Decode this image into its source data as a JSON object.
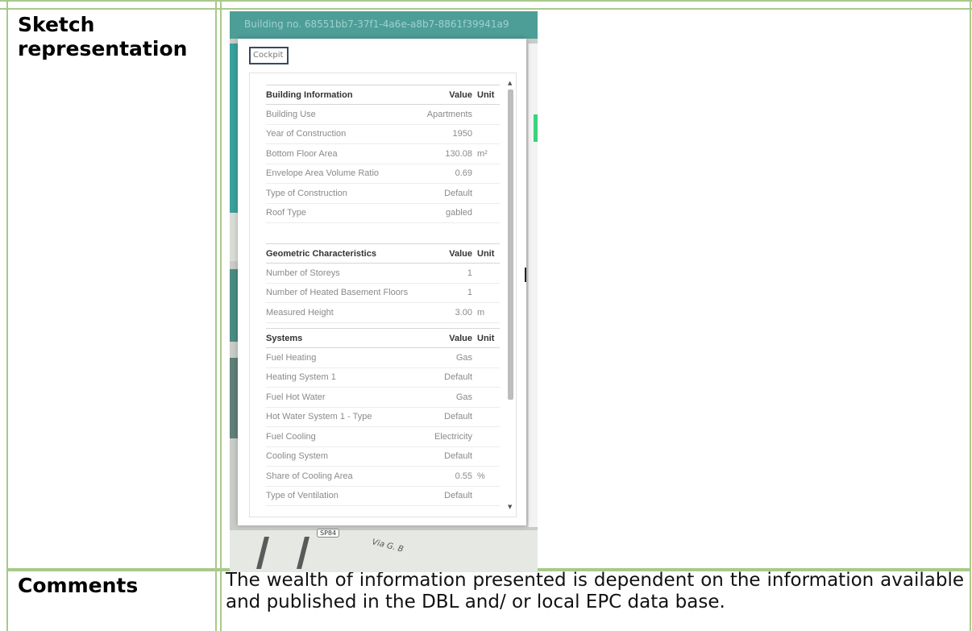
{
  "row_labels": {
    "sketch": "Sketch representation",
    "comments": "Comments"
  },
  "comment_text": "The wealth of information presented is dependent on the information available and published in the DBL and/ or local EPC data base.",
  "screenshot": {
    "title": "Building no. 68551bb7-37f1-4a6e-a8b7-8861f39941a9",
    "tab_label": "Cockpit",
    "map": {
      "road_badge": "SP84",
      "road_name": "Via G. B"
    },
    "sections": [
      {
        "header": {
          "name": "Building Information",
          "value": "Value",
          "unit": "Unit"
        },
        "rows": [
          {
            "name": "Building Use",
            "value": "Apartments",
            "unit": ""
          },
          {
            "name": "Year of Construction",
            "value": "1950",
            "unit": ""
          },
          {
            "name": "Bottom Floor Area",
            "value": "130.08",
            "unit": "m²"
          },
          {
            "name": "Envelope Area Volume Ratio",
            "value": "0.69",
            "unit": ""
          },
          {
            "name": "Type of Construction",
            "value": "Default",
            "unit": ""
          },
          {
            "name": "Roof Type",
            "value": "gabled",
            "unit": ""
          }
        ]
      },
      {
        "header": {
          "name": "Geometric Characteristics",
          "value": "Value",
          "unit": "Unit"
        },
        "rows": [
          {
            "name": "Number of Storeys",
            "value": "1",
            "unit": ""
          },
          {
            "name": "Number of Heated Basement Floors",
            "value": "1",
            "unit": ""
          },
          {
            "name": "Measured Height",
            "value": "3.00",
            "unit": "m"
          }
        ]
      },
      {
        "header": {
          "name": "Systems",
          "value": "Value",
          "unit": "Unit"
        },
        "rows": [
          {
            "name": "Fuel Heating",
            "value": "Gas",
            "unit": ""
          },
          {
            "name": "Heating System 1",
            "value": "Default",
            "unit": ""
          },
          {
            "name": "Fuel Hot Water",
            "value": "Gas",
            "unit": ""
          },
          {
            "name": "Hot Water System 1 - Type",
            "value": "Default",
            "unit": ""
          },
          {
            "name": "Fuel Cooling",
            "value": "Electricity",
            "unit": ""
          },
          {
            "name": "Cooling System",
            "value": "Default",
            "unit": ""
          },
          {
            "name": "Share of Cooling Area",
            "value": "0.55",
            "unit": "%"
          },
          {
            "name": "Type of Ventilation",
            "value": "Default",
            "unit": ""
          }
        ]
      }
    ]
  },
  "colors": {
    "table_border": "#a9c98a",
    "title_bar": "#4e9e98",
    "title_text": "#9fd1cc"
  }
}
